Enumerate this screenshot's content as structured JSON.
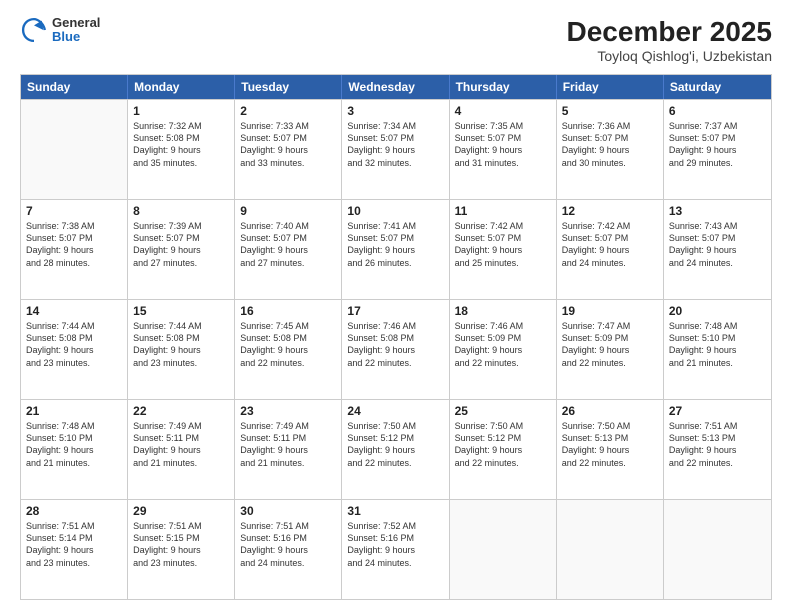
{
  "logo": {
    "general": "General",
    "blue": "Blue"
  },
  "title": "December 2025",
  "subtitle": "Toyloq Qishlog'i, Uzbekistan",
  "weekdays": [
    "Sunday",
    "Monday",
    "Tuesday",
    "Wednesday",
    "Thursday",
    "Friday",
    "Saturday"
  ],
  "rows": [
    [
      {
        "day": "",
        "empty": true,
        "lines": []
      },
      {
        "day": "1",
        "empty": false,
        "lines": [
          "Sunrise: 7:32 AM",
          "Sunset: 5:08 PM",
          "Daylight: 9 hours",
          "and 35 minutes."
        ]
      },
      {
        "day": "2",
        "empty": false,
        "lines": [
          "Sunrise: 7:33 AM",
          "Sunset: 5:07 PM",
          "Daylight: 9 hours",
          "and 33 minutes."
        ]
      },
      {
        "day": "3",
        "empty": false,
        "lines": [
          "Sunrise: 7:34 AM",
          "Sunset: 5:07 PM",
          "Daylight: 9 hours",
          "and 32 minutes."
        ]
      },
      {
        "day": "4",
        "empty": false,
        "lines": [
          "Sunrise: 7:35 AM",
          "Sunset: 5:07 PM",
          "Daylight: 9 hours",
          "and 31 minutes."
        ]
      },
      {
        "day": "5",
        "empty": false,
        "lines": [
          "Sunrise: 7:36 AM",
          "Sunset: 5:07 PM",
          "Daylight: 9 hours",
          "and 30 minutes."
        ]
      },
      {
        "day": "6",
        "empty": false,
        "lines": [
          "Sunrise: 7:37 AM",
          "Sunset: 5:07 PM",
          "Daylight: 9 hours",
          "and 29 minutes."
        ]
      }
    ],
    [
      {
        "day": "7",
        "empty": false,
        "lines": [
          "Sunrise: 7:38 AM",
          "Sunset: 5:07 PM",
          "Daylight: 9 hours",
          "and 28 minutes."
        ]
      },
      {
        "day": "8",
        "empty": false,
        "lines": [
          "Sunrise: 7:39 AM",
          "Sunset: 5:07 PM",
          "Daylight: 9 hours",
          "and 27 minutes."
        ]
      },
      {
        "day": "9",
        "empty": false,
        "lines": [
          "Sunrise: 7:40 AM",
          "Sunset: 5:07 PM",
          "Daylight: 9 hours",
          "and 27 minutes."
        ]
      },
      {
        "day": "10",
        "empty": false,
        "lines": [
          "Sunrise: 7:41 AM",
          "Sunset: 5:07 PM",
          "Daylight: 9 hours",
          "and 26 minutes."
        ]
      },
      {
        "day": "11",
        "empty": false,
        "lines": [
          "Sunrise: 7:42 AM",
          "Sunset: 5:07 PM",
          "Daylight: 9 hours",
          "and 25 minutes."
        ]
      },
      {
        "day": "12",
        "empty": false,
        "lines": [
          "Sunrise: 7:42 AM",
          "Sunset: 5:07 PM",
          "Daylight: 9 hours",
          "and 24 minutes."
        ]
      },
      {
        "day": "13",
        "empty": false,
        "lines": [
          "Sunrise: 7:43 AM",
          "Sunset: 5:07 PM",
          "Daylight: 9 hours",
          "and 24 minutes."
        ]
      }
    ],
    [
      {
        "day": "14",
        "empty": false,
        "lines": [
          "Sunrise: 7:44 AM",
          "Sunset: 5:08 PM",
          "Daylight: 9 hours",
          "and 23 minutes."
        ]
      },
      {
        "day": "15",
        "empty": false,
        "lines": [
          "Sunrise: 7:44 AM",
          "Sunset: 5:08 PM",
          "Daylight: 9 hours",
          "and 23 minutes."
        ]
      },
      {
        "day": "16",
        "empty": false,
        "lines": [
          "Sunrise: 7:45 AM",
          "Sunset: 5:08 PM",
          "Daylight: 9 hours",
          "and 22 minutes."
        ]
      },
      {
        "day": "17",
        "empty": false,
        "lines": [
          "Sunrise: 7:46 AM",
          "Sunset: 5:08 PM",
          "Daylight: 9 hours",
          "and 22 minutes."
        ]
      },
      {
        "day": "18",
        "empty": false,
        "lines": [
          "Sunrise: 7:46 AM",
          "Sunset: 5:09 PM",
          "Daylight: 9 hours",
          "and 22 minutes."
        ]
      },
      {
        "day": "19",
        "empty": false,
        "lines": [
          "Sunrise: 7:47 AM",
          "Sunset: 5:09 PM",
          "Daylight: 9 hours",
          "and 22 minutes."
        ]
      },
      {
        "day": "20",
        "empty": false,
        "lines": [
          "Sunrise: 7:48 AM",
          "Sunset: 5:10 PM",
          "Daylight: 9 hours",
          "and 21 minutes."
        ]
      }
    ],
    [
      {
        "day": "21",
        "empty": false,
        "lines": [
          "Sunrise: 7:48 AM",
          "Sunset: 5:10 PM",
          "Daylight: 9 hours",
          "and 21 minutes."
        ]
      },
      {
        "day": "22",
        "empty": false,
        "lines": [
          "Sunrise: 7:49 AM",
          "Sunset: 5:11 PM",
          "Daylight: 9 hours",
          "and 21 minutes."
        ]
      },
      {
        "day": "23",
        "empty": false,
        "lines": [
          "Sunrise: 7:49 AM",
          "Sunset: 5:11 PM",
          "Daylight: 9 hours",
          "and 21 minutes."
        ]
      },
      {
        "day": "24",
        "empty": false,
        "lines": [
          "Sunrise: 7:50 AM",
          "Sunset: 5:12 PM",
          "Daylight: 9 hours",
          "and 22 minutes."
        ]
      },
      {
        "day": "25",
        "empty": false,
        "lines": [
          "Sunrise: 7:50 AM",
          "Sunset: 5:12 PM",
          "Daylight: 9 hours",
          "and 22 minutes."
        ]
      },
      {
        "day": "26",
        "empty": false,
        "lines": [
          "Sunrise: 7:50 AM",
          "Sunset: 5:13 PM",
          "Daylight: 9 hours",
          "and 22 minutes."
        ]
      },
      {
        "day": "27",
        "empty": false,
        "lines": [
          "Sunrise: 7:51 AM",
          "Sunset: 5:13 PM",
          "Daylight: 9 hours",
          "and 22 minutes."
        ]
      }
    ],
    [
      {
        "day": "28",
        "empty": false,
        "lines": [
          "Sunrise: 7:51 AM",
          "Sunset: 5:14 PM",
          "Daylight: 9 hours",
          "and 23 minutes."
        ]
      },
      {
        "day": "29",
        "empty": false,
        "lines": [
          "Sunrise: 7:51 AM",
          "Sunset: 5:15 PM",
          "Daylight: 9 hours",
          "and 23 minutes."
        ]
      },
      {
        "day": "30",
        "empty": false,
        "lines": [
          "Sunrise: 7:51 AM",
          "Sunset: 5:16 PM",
          "Daylight: 9 hours",
          "and 24 minutes."
        ]
      },
      {
        "day": "31",
        "empty": false,
        "lines": [
          "Sunrise: 7:52 AM",
          "Sunset: 5:16 PM",
          "Daylight: 9 hours",
          "and 24 minutes."
        ]
      },
      {
        "day": "",
        "empty": true,
        "lines": []
      },
      {
        "day": "",
        "empty": true,
        "lines": []
      },
      {
        "day": "",
        "empty": true,
        "lines": []
      }
    ]
  ]
}
